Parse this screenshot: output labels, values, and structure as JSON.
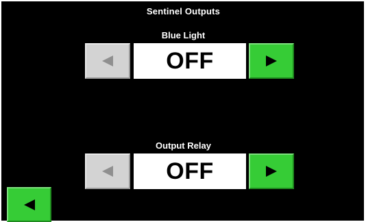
{
  "screen": {
    "title": "Sentinel Outputs"
  },
  "controls": [
    {
      "label": "Blue Light",
      "value": "OFF",
      "prev_icon": "left-arrow-icon",
      "next_icon": "right-arrow-icon",
      "prev_enabled": false,
      "next_enabled": true
    },
    {
      "label": "Output Relay",
      "value": "OFF",
      "prev_icon": "left-arrow-icon",
      "next_icon": "right-arrow-icon",
      "prev_enabled": false,
      "next_enabled": true
    }
  ],
  "navigation": {
    "back_icon": "left-arrow-icon"
  },
  "colors": {
    "background": "#000000",
    "enabled_button": "#36cc36",
    "disabled_button": "#d3d3d3",
    "value_box": "#ffffff"
  }
}
